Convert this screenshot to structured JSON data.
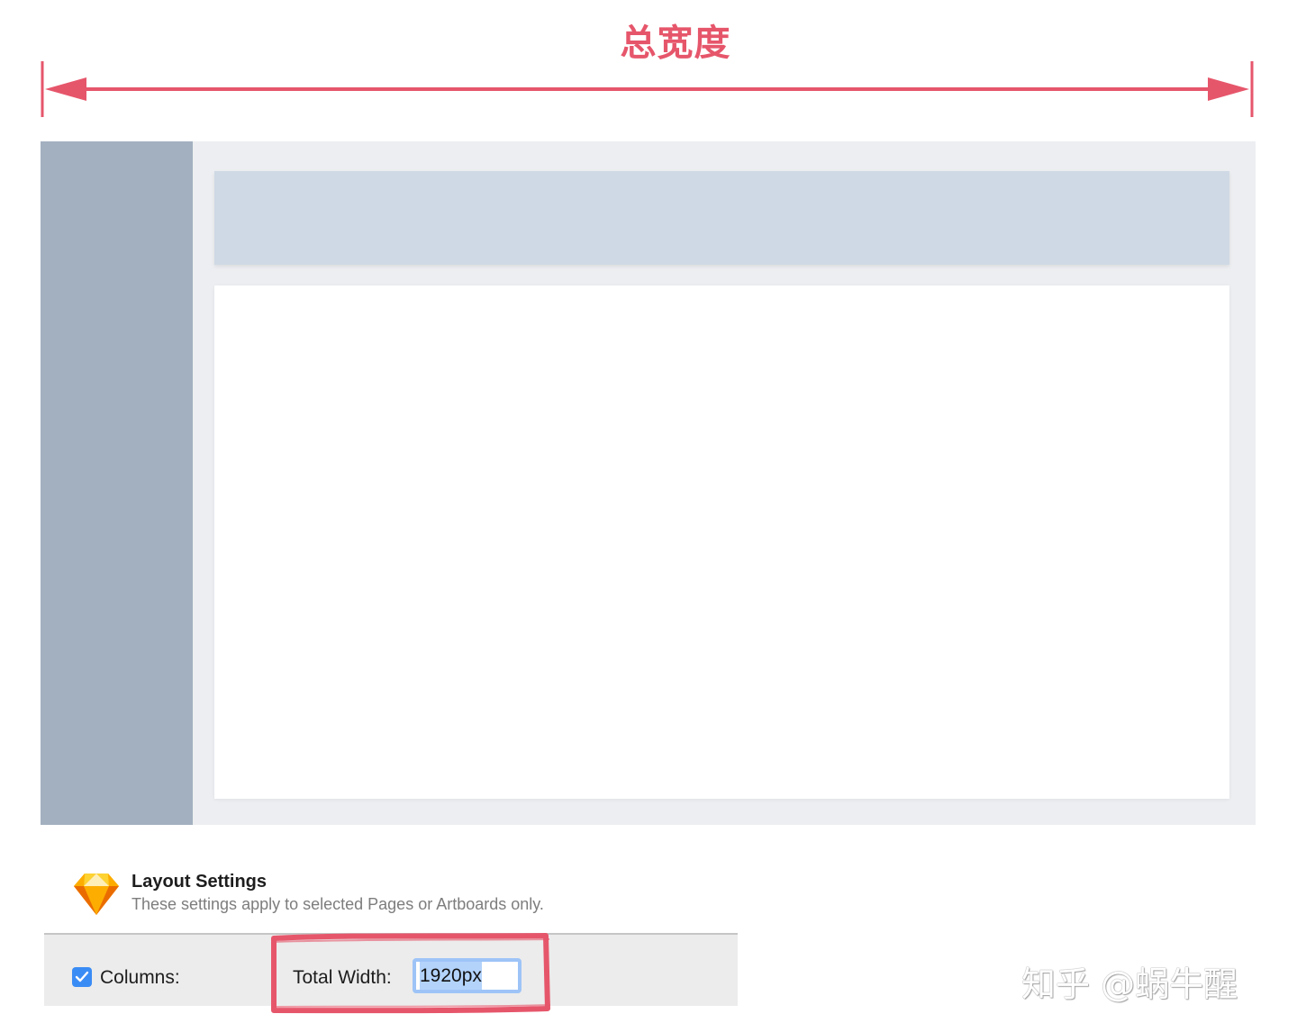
{
  "annotation": {
    "title": "总宽度",
    "color": "#e6566b"
  },
  "mockup": {
    "sidebar_color": "#a3b0c0",
    "header_color": "#cfd9e5",
    "background_color": "#eceef1",
    "content_color": "#ffffff"
  },
  "settings": {
    "icon": "sketch-diamond-icon",
    "title": "Layout Settings",
    "subtitle": "These settings apply to selected Pages or Artboards only.",
    "columns_label": "Columns:",
    "columns_checked": true,
    "total_width_label": "Total Width:",
    "total_width_value": "1920px"
  },
  "watermark": {
    "text": "知乎 @蜗牛醒"
  }
}
